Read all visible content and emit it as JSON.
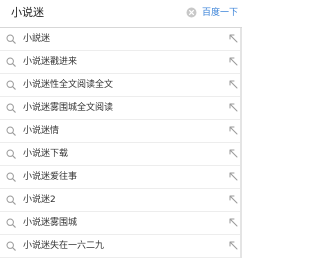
{
  "search": {
    "value": "小说迷",
    "button_label": "百度一下"
  },
  "icons": {
    "clear": "clear-circle-icon",
    "suggestion": "search-icon",
    "fill": "arrow-up-left-icon"
  },
  "colors": {
    "button_text": "#3b83d8",
    "clear_icon": "#c8c8c8",
    "item_icon": "#9a9a9a",
    "divider": "#ededed"
  },
  "suggestions": [
    {
      "label": "小説迷"
    },
    {
      "label": "小说迷戳进来"
    },
    {
      "label": "小说迷性全文阅读全文"
    },
    {
      "label": "小说迷雾围城全文阅读"
    },
    {
      "label": "小说迷情"
    },
    {
      "label": "小说迷下载"
    },
    {
      "label": "小说迷爱往事"
    },
    {
      "label": "小说迷2"
    },
    {
      "label": "小说迷雾围城"
    },
    {
      "label": "小说迷失在一六二九"
    }
  ]
}
